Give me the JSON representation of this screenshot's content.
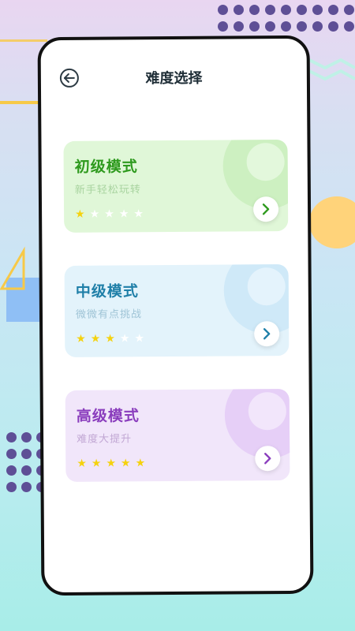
{
  "header": {
    "title": "难度选择",
    "back_icon": "arrow-left-icon"
  },
  "modes": [
    {
      "title": "初级模式",
      "subtitle": "新手轻松玩转",
      "stars_filled": 1,
      "stars_total": 5,
      "accent": "#2e9a1e"
    },
    {
      "title": "中级模式",
      "subtitle": "微微有点挑战",
      "stars_filled": 3,
      "stars_total": 5,
      "accent": "#1f7fa8"
    },
    {
      "title": "高级模式",
      "subtitle": "难度大提升",
      "stars_filled": 5,
      "stars_total": 5,
      "accent": "#8a3dbd"
    }
  ],
  "colors": {
    "star_on": "#f5d20e",
    "star_off": "#ffffff"
  }
}
